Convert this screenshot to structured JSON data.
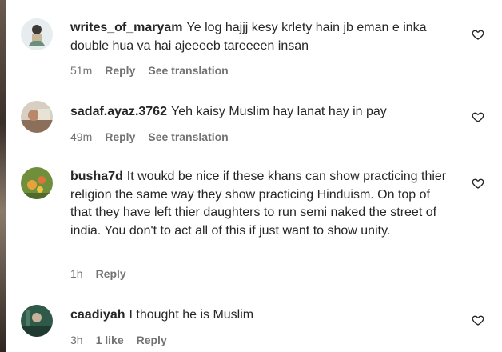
{
  "comments": [
    {
      "username": "writes_of_maryam",
      "text": "Ye log hajjj kesy krlety hain jb eman e inka double hua va hai ajeeeeb tareeeen insan",
      "time": "51m",
      "reply_label": "Reply",
      "translate_label": "See translation",
      "avatar_icon": "avatar-illustration-icon",
      "like_icon": "heart-outline-icon"
    },
    {
      "username": "sadaf.ayaz.3762",
      "text": "Yeh kaisy Muslim hay lanat hay in pay",
      "time": "49m",
      "reply_label": "Reply",
      "translate_label": "See translation",
      "avatar_icon": "avatar-photo-icon",
      "like_icon": "heart-outline-icon"
    },
    {
      "username": "busha7d",
      "text": "It woukd be nice if these khans can show practicing thier religion the same way they show practicing Hinduism. On top of that they have left thier daughters to run semi naked the street of india. You don't to act all of this if just want to show unity.",
      "time": "1h",
      "reply_label": "Reply",
      "avatar_icon": "avatar-flower-icon",
      "like_icon": "heart-outline-icon"
    },
    {
      "username": "caadiyah",
      "text": "I thought he is Muslim",
      "time": "3h",
      "likes_label": "1 like",
      "reply_label": "Reply",
      "avatar_icon": "avatar-photo-icon",
      "like_icon": "heart-outline-icon"
    }
  ],
  "colors": {
    "text": "#262626",
    "secondary": "#737373",
    "background": "#ffffff"
  }
}
